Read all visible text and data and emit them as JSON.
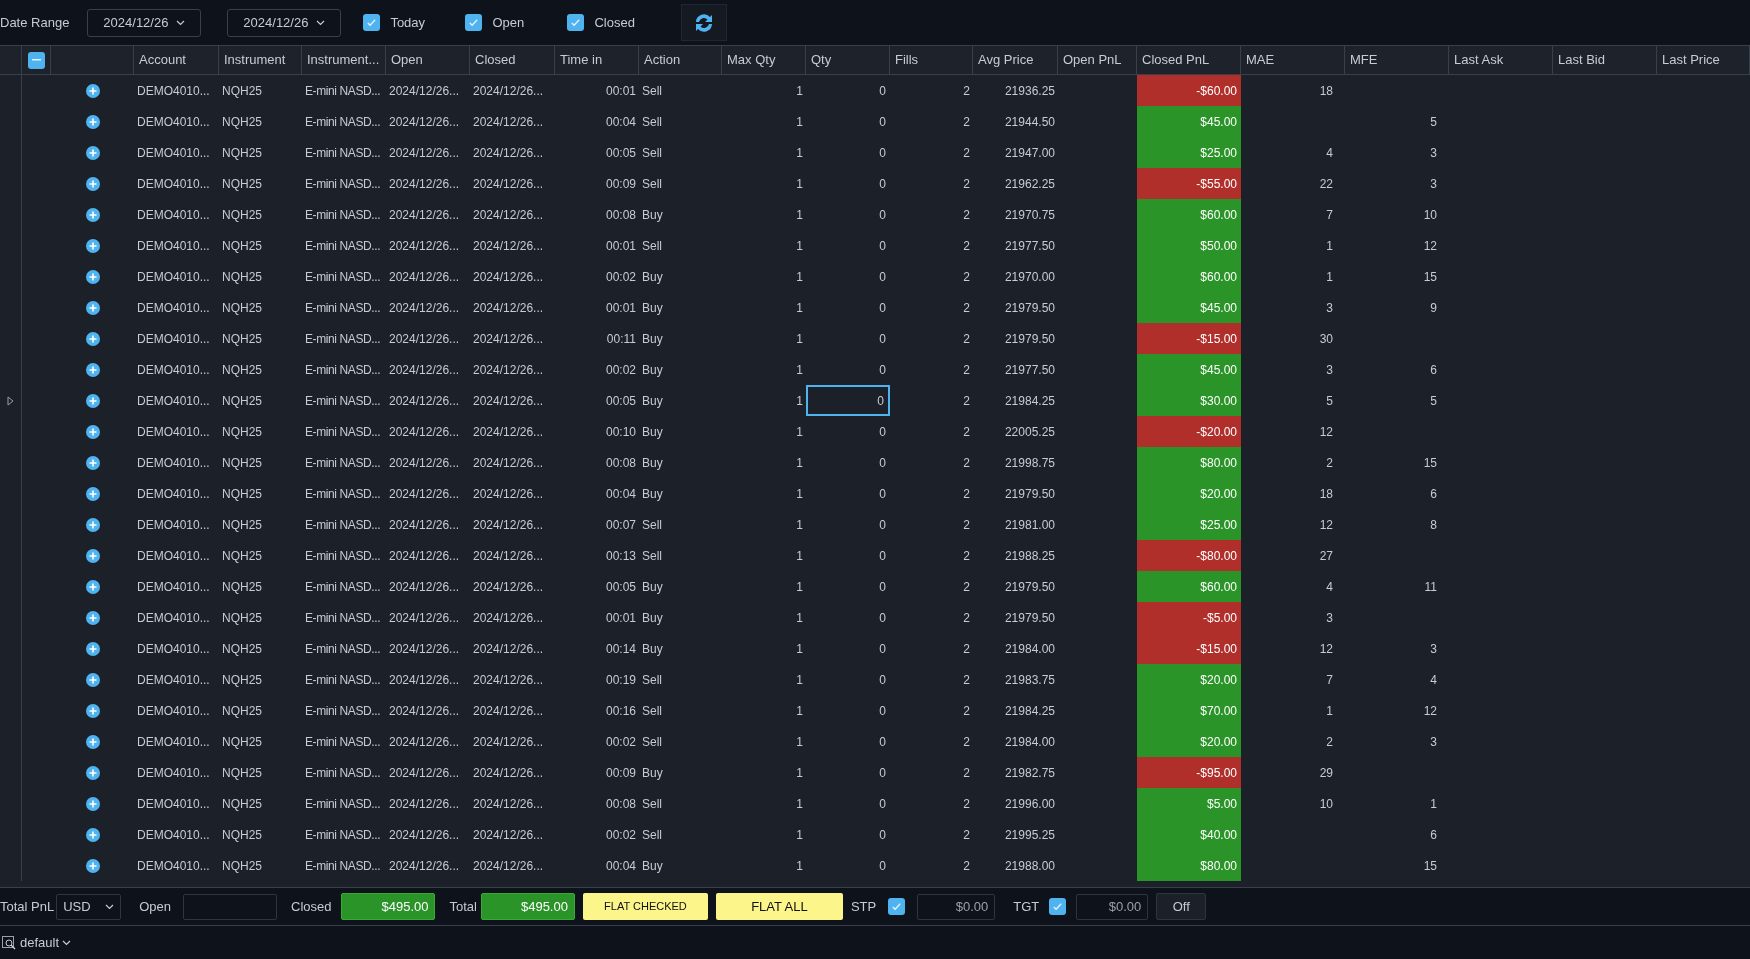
{
  "toolbar": {
    "label": "Date Range",
    "from": "2024/12/26",
    "to": "2024/12/26",
    "filters": [
      {
        "label": "Today",
        "checked": true
      },
      {
        "label": "Open",
        "checked": true
      },
      {
        "label": "Closed",
        "checked": true
      }
    ]
  },
  "table": {
    "columns": [
      "Account",
      "Instrument",
      "Instrument...",
      "Open",
      "Closed",
      "Time in",
      "Action",
      "Max Qty",
      "Qty",
      "Fills",
      "Avg Price",
      "Open PnL",
      "Closed PnL",
      "MAE",
      "MFE",
      "Last Ask",
      "Last Bid",
      "Last Price"
    ],
    "rows": [
      {
        "account": "DEMO4010...",
        "instrument": "NQH25",
        "instrument_name": "E-mini NASD...",
        "open": "2024/12/26...",
        "closed": "2024/12/26...",
        "time_in": "00:01",
        "action": "Sell",
        "max_qty": "1",
        "qty": "0",
        "fills": "2",
        "avg_price": "21936.25",
        "closed_pnl": "-$60.00",
        "color": "#b02f2b",
        "mae": "18",
        "selected": false
      },
      {
        "account": "DEMO4010...",
        "instrument": "NQH25",
        "instrument_name": "E-mini NASD...",
        "open": "2024/12/26...",
        "closed": "2024/12/26...",
        "time_in": "00:04",
        "action": "Sell",
        "max_qty": "1",
        "qty": "0",
        "fills": "2",
        "avg_price": "21944.50",
        "closed_pnl": "$45.00",
        "color": "#2a9428",
        "mfe": "5",
        "selected": false
      },
      {
        "account": "DEMO4010...",
        "instrument": "NQH25",
        "instrument_name": "E-mini NASD...",
        "open": "2024/12/26...",
        "closed": "2024/12/26...",
        "time_in": "00:05",
        "action": "Sell",
        "max_qty": "1",
        "qty": "0",
        "fills": "2",
        "avg_price": "21947.00",
        "closed_pnl": "$25.00",
        "color": "#2a9428",
        "mae": "4",
        "mfe": "3",
        "selected": false
      },
      {
        "account": "DEMO4010...",
        "instrument": "NQH25",
        "instrument_name": "E-mini NASD...",
        "open": "2024/12/26...",
        "closed": "2024/12/26...",
        "time_in": "00:09",
        "action": "Sell",
        "max_qty": "1",
        "qty": "0",
        "fills": "2",
        "avg_price": "21962.25",
        "closed_pnl": "-$55.00",
        "color": "#b02f2b",
        "mae": "22",
        "mfe": "3",
        "selected": false
      },
      {
        "account": "DEMO4010...",
        "instrument": "NQH25",
        "instrument_name": "E-mini NASD...",
        "open": "2024/12/26...",
        "closed": "2024/12/26...",
        "time_in": "00:08",
        "action": "Buy",
        "max_qty": "1",
        "qty": "0",
        "fills": "2",
        "avg_price": "21970.75",
        "closed_pnl": "$60.00",
        "color": "#2a9428",
        "mae": "7",
        "mfe": "10",
        "selected": false
      },
      {
        "account": "DEMO4010...",
        "instrument": "NQH25",
        "instrument_name": "E-mini NASD...",
        "open": "2024/12/26...",
        "closed": "2024/12/26...",
        "time_in": "00:01",
        "action": "Sell",
        "max_qty": "1",
        "qty": "0",
        "fills": "2",
        "avg_price": "21977.50",
        "closed_pnl": "$50.00",
        "color": "#2a9428",
        "mae": "1",
        "mfe": "12",
        "selected": false
      },
      {
        "account": "DEMO4010...",
        "instrument": "NQH25",
        "instrument_name": "E-mini NASD...",
        "open": "2024/12/26...",
        "closed": "2024/12/26...",
        "time_in": "00:02",
        "action": "Buy",
        "max_qty": "1",
        "qty": "0",
        "fills": "2",
        "avg_price": "21970.00",
        "closed_pnl": "$60.00",
        "color": "#2a9428",
        "mae": "1",
        "mfe": "15",
        "selected": false
      },
      {
        "account": "DEMO4010...",
        "instrument": "NQH25",
        "instrument_name": "E-mini NASD...",
        "open": "2024/12/26...",
        "closed": "2024/12/26...",
        "time_in": "00:01",
        "action": "Buy",
        "max_qty": "1",
        "qty": "0",
        "fills": "2",
        "avg_price": "21979.50",
        "closed_pnl": "$45.00",
        "color": "#2a9428",
        "mae": "3",
        "mfe": "9",
        "selected": false
      },
      {
        "account": "DEMO4010...",
        "instrument": "NQH25",
        "instrument_name": "E-mini NASD...",
        "open": "2024/12/26...",
        "closed": "2024/12/26...",
        "time_in": "00:11",
        "action": "Buy",
        "max_qty": "1",
        "qty": "0",
        "fills": "2",
        "avg_price": "21979.50",
        "closed_pnl": "-$15.00",
        "color": "#b02f2b",
        "mae": "30",
        "selected": false
      },
      {
        "account": "DEMO4010...",
        "instrument": "NQH25",
        "instrument_name": "E-mini NASD...",
        "open": "2024/12/26...",
        "closed": "2024/12/26...",
        "time_in": "00:02",
        "action": "Buy",
        "max_qty": "1",
        "qty": "0",
        "fills": "2",
        "avg_price": "21977.50",
        "closed_pnl": "$45.00",
        "color": "#2a9428",
        "mae": "3",
        "mfe": "6",
        "selected": false
      },
      {
        "account": "DEMO4010...",
        "instrument": "NQH25",
        "instrument_name": "E-mini NASD...",
        "open": "2024/12/26...",
        "closed": "2024/12/26...",
        "time_in": "00:05",
        "action": "Buy",
        "max_qty": "1",
        "qty": "0",
        "fills": "2",
        "avg_price": "21984.25",
        "closed_pnl": "$30.00",
        "color": "#2a9428",
        "mae": "5",
        "mfe": "5",
        "selected": true
      },
      {
        "account": "DEMO4010...",
        "instrument": "NQH25",
        "instrument_name": "E-mini NASD...",
        "open": "2024/12/26...",
        "closed": "2024/12/26...",
        "time_in": "00:10",
        "action": "Buy",
        "max_qty": "1",
        "qty": "0",
        "fills": "2",
        "avg_price": "22005.25",
        "closed_pnl": "-$20.00",
        "color": "#b02f2b",
        "mae": "12",
        "selected": false
      },
      {
        "account": "DEMO4010...",
        "instrument": "NQH25",
        "instrument_name": "E-mini NASD...",
        "open": "2024/12/26...",
        "closed": "2024/12/26...",
        "time_in": "00:08",
        "action": "Buy",
        "max_qty": "1",
        "qty": "0",
        "fills": "2",
        "avg_price": "21998.75",
        "closed_pnl": "$80.00",
        "color": "#2a9428",
        "mae": "2",
        "mfe": "15",
        "selected": false
      },
      {
        "account": "DEMO4010...",
        "instrument": "NQH25",
        "instrument_name": "E-mini NASD...",
        "open": "2024/12/26...",
        "closed": "2024/12/26...",
        "time_in": "00:04",
        "action": "Buy",
        "max_qty": "1",
        "qty": "0",
        "fills": "2",
        "avg_price": "21979.50",
        "closed_pnl": "$20.00",
        "color": "#2a9428",
        "mae": "18",
        "mfe": "6",
        "selected": false
      },
      {
        "account": "DEMO4010...",
        "instrument": "NQH25",
        "instrument_name": "E-mini NASD...",
        "open": "2024/12/26...",
        "closed": "2024/12/26...",
        "time_in": "00:07",
        "action": "Sell",
        "max_qty": "1",
        "qty": "0",
        "fills": "2",
        "avg_price": "21981.00",
        "closed_pnl": "$25.00",
        "color": "#2a9428",
        "mae": "12",
        "mfe": "8",
        "selected": false
      },
      {
        "account": "DEMO4010...",
        "instrument": "NQH25",
        "instrument_name": "E-mini NASD...",
        "open": "2024/12/26...",
        "closed": "2024/12/26...",
        "time_in": "00:13",
        "action": "Sell",
        "max_qty": "1",
        "qty": "0",
        "fills": "2",
        "avg_price": "21988.25",
        "closed_pnl": "-$80.00",
        "color": "#b02f2b",
        "mae": "27",
        "selected": false
      },
      {
        "account": "DEMO4010...",
        "instrument": "NQH25",
        "instrument_name": "E-mini NASD...",
        "open": "2024/12/26...",
        "closed": "2024/12/26...",
        "time_in": "00:05",
        "action": "Buy",
        "max_qty": "1",
        "qty": "0",
        "fills": "2",
        "avg_price": "21979.50",
        "closed_pnl": "$60.00",
        "color": "#2a9428",
        "mae": "4",
        "mfe": "11",
        "selected": false
      },
      {
        "account": "DEMO4010...",
        "instrument": "NQH25",
        "instrument_name": "E-mini NASD...",
        "open": "2024/12/26...",
        "closed": "2024/12/26...",
        "time_in": "00:01",
        "action": "Buy",
        "max_qty": "1",
        "qty": "0",
        "fills": "2",
        "avg_price": "21979.50",
        "closed_pnl": "-$5.00",
        "color": "#b02f2b",
        "mae": "3",
        "selected": false
      },
      {
        "account": "DEMO4010...",
        "instrument": "NQH25",
        "instrument_name": "E-mini NASD...",
        "open": "2024/12/26...",
        "closed": "2024/12/26...",
        "time_in": "00:14",
        "action": "Buy",
        "max_qty": "1",
        "qty": "0",
        "fills": "2",
        "avg_price": "21984.00",
        "closed_pnl": "-$15.00",
        "color": "#b02f2b",
        "mae": "12",
        "mfe": "3",
        "selected": false
      },
      {
        "account": "DEMO4010...",
        "instrument": "NQH25",
        "instrument_name": "E-mini NASD...",
        "open": "2024/12/26...",
        "closed": "2024/12/26...",
        "time_in": "00:19",
        "action": "Sell",
        "max_qty": "1",
        "qty": "0",
        "fills": "2",
        "avg_price": "21983.75",
        "closed_pnl": "$20.00",
        "color": "#2a9428",
        "mae": "7",
        "mfe": "4",
        "selected": false
      },
      {
        "account": "DEMO4010...",
        "instrument": "NQH25",
        "instrument_name": "E-mini NASD...",
        "open": "2024/12/26...",
        "closed": "2024/12/26...",
        "time_in": "00:16",
        "action": "Sell",
        "max_qty": "1",
        "qty": "0",
        "fills": "2",
        "avg_price": "21984.25",
        "closed_pnl": "$70.00",
        "color": "#2a9428",
        "mae": "1",
        "mfe": "12",
        "selected": false
      },
      {
        "account": "DEMO4010...",
        "instrument": "NQH25",
        "instrument_name": "E-mini NASD...",
        "open": "2024/12/26...",
        "closed": "2024/12/26...",
        "time_in": "00:02",
        "action": "Sell",
        "max_qty": "1",
        "qty": "0",
        "fills": "2",
        "avg_price": "21984.00",
        "closed_pnl": "$20.00",
        "color": "#2a9428",
        "mae": "2",
        "mfe": "3",
        "selected": false
      },
      {
        "account": "DEMO4010...",
        "instrument": "NQH25",
        "instrument_name": "E-mini NASD...",
        "open": "2024/12/26...",
        "closed": "2024/12/26...",
        "time_in": "00:09",
        "action": "Buy",
        "max_qty": "1",
        "qty": "0",
        "fills": "2",
        "avg_price": "21982.75",
        "closed_pnl": "-$95.00",
        "color": "#b02f2b",
        "mae": "29",
        "selected": false
      },
      {
        "account": "DEMO4010...",
        "instrument": "NQH25",
        "instrument_name": "E-mini NASD...",
        "open": "2024/12/26...",
        "closed": "2024/12/26...",
        "time_in": "00:08",
        "action": "Sell",
        "max_qty": "1",
        "qty": "0",
        "fills": "2",
        "avg_price": "21996.00",
        "closed_pnl": "$5.00",
        "color": "#2a9428",
        "mae": "10",
        "mfe": "1",
        "selected": false
      },
      {
        "account": "DEMO4010...",
        "instrument": "NQH25",
        "instrument_name": "E-mini NASD...",
        "open": "2024/12/26...",
        "closed": "2024/12/26...",
        "time_in": "00:02",
        "action": "Sell",
        "max_qty": "1",
        "qty": "0",
        "fills": "2",
        "avg_price": "21995.25",
        "closed_pnl": "$40.00",
        "color": "#2a9428",
        "mfe": "6",
        "selected": false
      },
      {
        "account": "DEMO4010...",
        "instrument": "NQH25",
        "instrument_name": "E-mini NASD...",
        "open": "2024/12/26...",
        "closed": "2024/12/26...",
        "time_in": "00:04",
        "action": "Buy",
        "max_qty": "1",
        "qty": "0",
        "fills": "2",
        "avg_price": "21988.00",
        "closed_pnl": "$80.00",
        "color": "#2a9428",
        "mfe": "15",
        "selected": false
      }
    ]
  },
  "footer": {
    "total_pnl_label": "Total PnL",
    "currency": "USD",
    "open_label": "Open",
    "closed_label": "Closed",
    "closed_value": "$495.00",
    "total_label": "Total",
    "total_value": "$495.00",
    "flat_checked": "FLAT CHECKED",
    "flat_all": "FLAT ALL",
    "stp": {
      "label": "STP",
      "checked": true,
      "value": "$0.00"
    },
    "tgt": {
      "label": "TGT",
      "checked": true,
      "value": "$0.00"
    },
    "off": "Off"
  },
  "status_bar": {
    "workspace": "default"
  }
}
